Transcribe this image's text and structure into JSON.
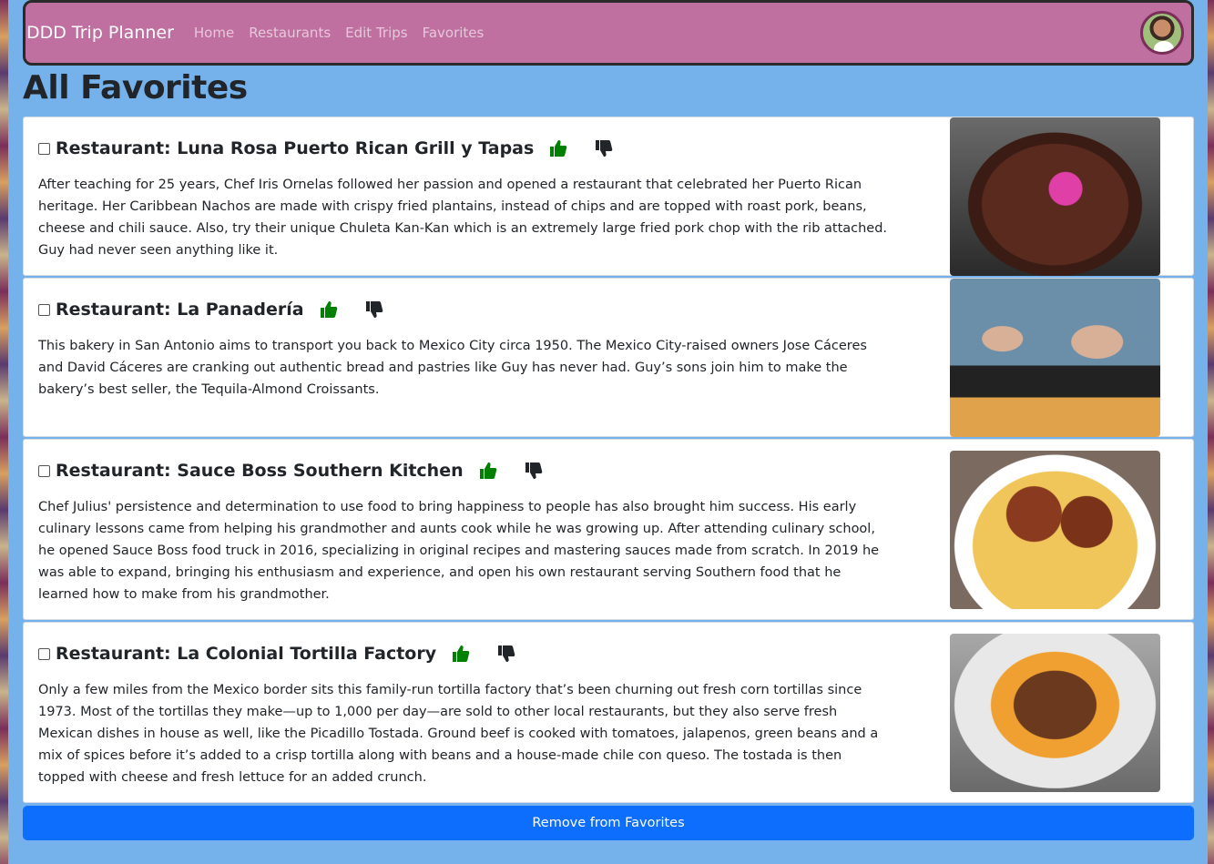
{
  "navbar": {
    "brand": "DDD Trip Planner",
    "links": [
      "Home",
      "Restaurants",
      "Edit Trips",
      "Favorites"
    ]
  },
  "page_title": "All Favorites",
  "favorites": [
    {
      "title": "Restaurant: Luna Rosa Puerto Rican Grill y Tapas",
      "description": "After teaching for 25 years, Chef Iris Ornelas followed her passion and opened a restaurant that celebrated her Puerto Rican heritage. Her Caribbean Nachos are made with crispy fried plantains, instead of chips and are topped with roast pork, beans, cheese and chili sauce. Also, try their unique Chuleta Kan-Kan which is an extremely large fried pork chop with the rib attached. Guy had never seen anything like it."
    },
    {
      "title": "Restaurant: La Panadería",
      "description": "This bakery in San Antonio aims to transport you back to Mexico City circa 1950. The Mexico City-raised owners Jose Cáceres and David Cáceres are cranking out authentic bread and pastries like Guy has never had. Guy’s sons join him to make the bakery’s best seller, the Tequila-Almond Croissants."
    },
    {
      "title": "Restaurant: Sauce Boss Southern Kitchen",
      "description": "Chef Julius' persistence and determination to use food to bring happiness to people has also brought him success. His early culinary lessons came from helping his grandmother and aunts cook while he was growing up. After attending culinary school, he opened Sauce Boss food truck in 2016, specializing in original recipes and mastering sauces made from scratch. In 2019 he was able to expand, bringing his enthusiasm and experience, and open his own restaurant serving Southern food that he learned how to make from his grandmother."
    },
    {
      "title": "Restaurant: La Colonial Tortilla Factory",
      "description": "Only a few miles from the Mexico border sits this family-run tortilla factory that’s been churning out fresh corn tortillas since 1973. Most of the tortillas they make—up to 1,000 per day—are sold to other local restaurants, but they also serve fresh Mexican dishes in house as well, like the Picadillo Tostada. Ground beef is cooked with tomatoes, jalapenos, green beans and a mix of spices before it’s added to a crisp tortilla along with beans and a house-made chile con queso. The tostada is then topped with cheese and fresh lettuce for an added crunch."
    }
  ],
  "remove_button": "Remove from Favorites",
  "icons": {
    "thumb_up": "thumbs-up-icon",
    "thumb_down": "thumbs-down-icon",
    "thumb_up_color": "#008000",
    "thumb_down_color": "#212529"
  },
  "colors": {
    "background": "#75b2ec",
    "navbar": "#bf6fa0",
    "button": "#0d6efd"
  }
}
